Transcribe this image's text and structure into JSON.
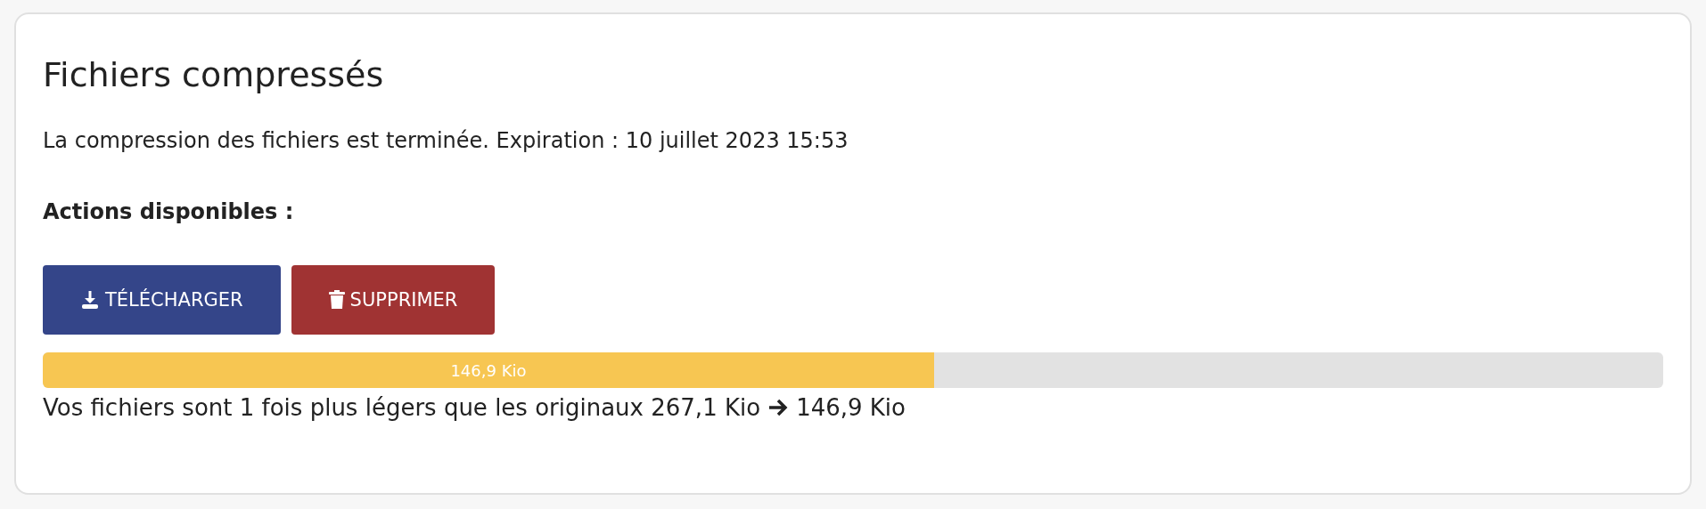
{
  "title": "Fichiers compressés",
  "message": "La compression des fichiers est terminée. Expiration : 10 juillet 2023 15:53",
  "actions_heading": "Actions disponibles :",
  "buttons": [
    {
      "kind": "download",
      "label": "TÉLÉCHARGER"
    },
    {
      "kind": "delete",
      "label": "SUPPRIMER"
    }
  ],
  "progress": {
    "level": 0.55,
    "label": "146,9 Kio"
  },
  "summary": {
    "text": "Vos fichiers sont 1 fois plus légers que les originaux 267,1 Kio",
    "result": "146,9 Kio"
  }
}
